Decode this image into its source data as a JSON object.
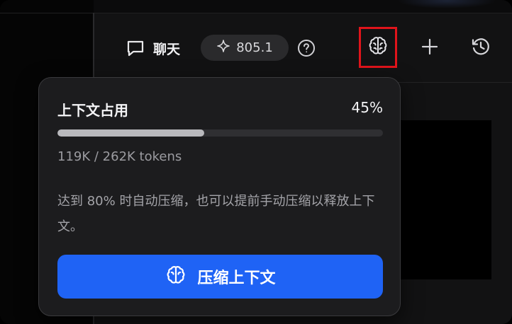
{
  "header": {
    "chat_label": "聊天",
    "credits": "805.1",
    "icons": {
      "chat": "chat-bubble-icon",
      "sparkle": "sparkle-icon",
      "help": "help-circle-icon",
      "brain": "brain-icon",
      "plus": "plus-icon",
      "history": "history-icon"
    }
  },
  "context_popover": {
    "title": "上下文占用",
    "percent_label": "45%",
    "usage_fraction": 0.45,
    "tokens": "119K / 262K tokens",
    "description": "达到 80% 时自动压缩，也可以提前手动压缩以释放上下文。",
    "button_label": "压缩上下文"
  },
  "colors": {
    "accent_button": "#1f63f5",
    "highlight_border": "#e0141b",
    "progress_fill": "#b9b9bd"
  }
}
